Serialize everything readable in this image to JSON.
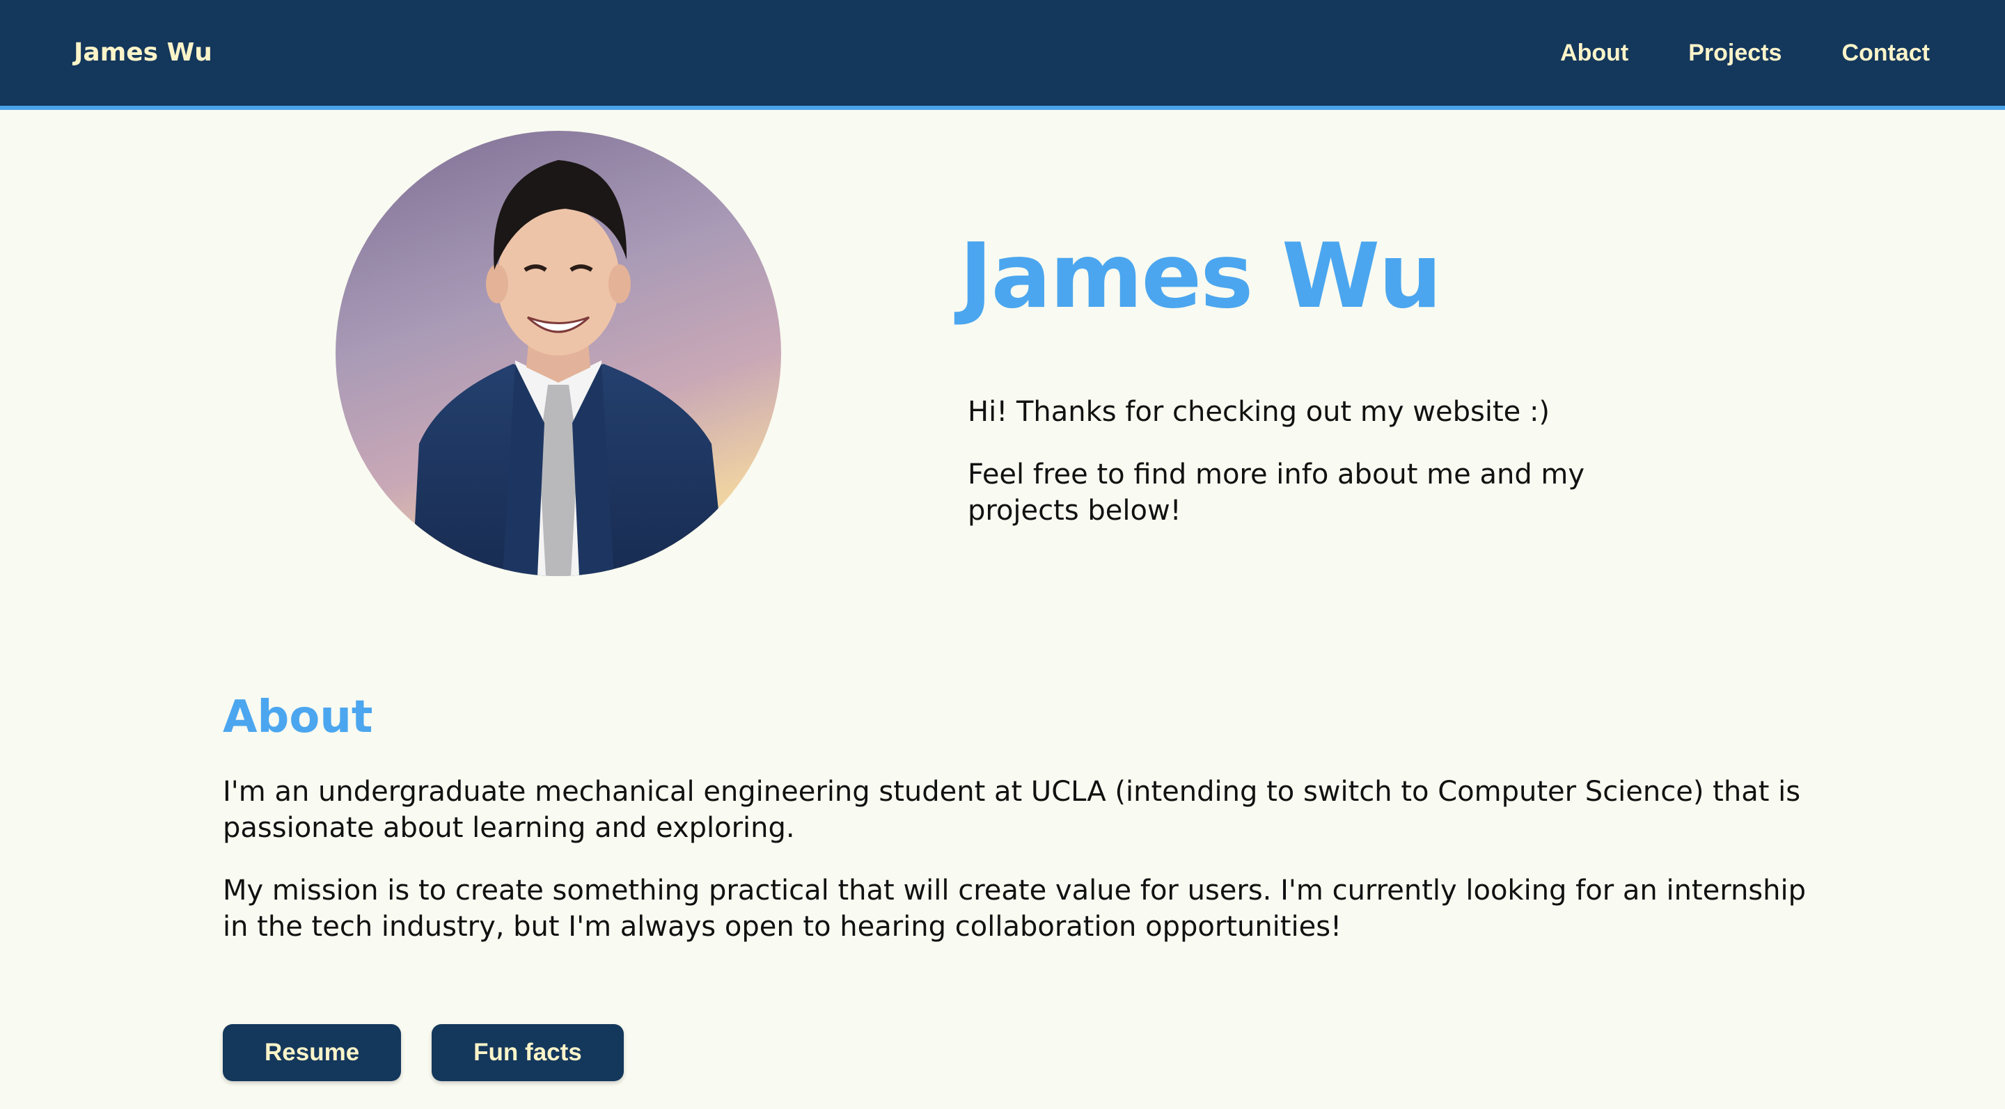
{
  "nav": {
    "brand": "James Wu",
    "links": [
      "About",
      "Projects",
      "Contact"
    ]
  },
  "hero": {
    "title": "James Wu",
    "greeting": "Hi! Thanks for checking out my website :)",
    "invite": "Feel free to find more info about me and my projects below!"
  },
  "about": {
    "heading": "About",
    "paragraphs": [
      "I'm an undergraduate mechanical engineering student at UCLA (intending to switch to Computer Science) that is passionate about learning and exploring.",
      "My mission is to create something practical that will create value for users. I'm currently looking for an internship in the tech industry, but I'm always open to hearing collaboration opportunities!"
    ]
  },
  "buttons": {
    "resume": "Resume",
    "fun_facts": "Fun facts"
  },
  "colors": {
    "navbar": "#14375c",
    "accent": "#4ba6ef",
    "nav_text": "#fbf4c9",
    "background": "#f9faf1"
  },
  "icons": {
    "avatar": "profile-photo"
  }
}
